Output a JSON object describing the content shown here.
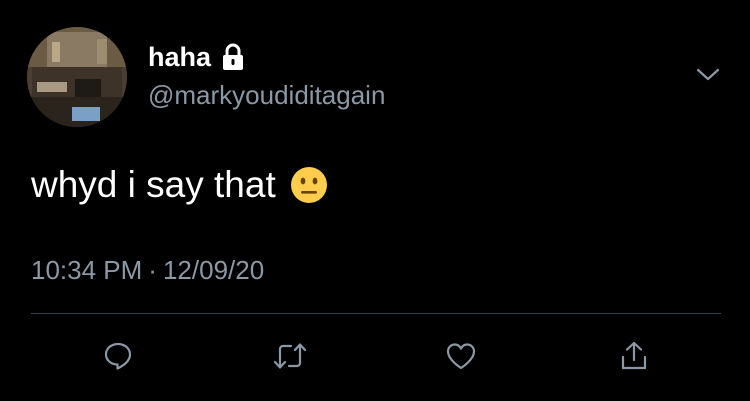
{
  "tweet": {
    "display_name": "haha",
    "handle": "@markyoudiditagain",
    "text": "whyd i say that",
    "emoji": "neutral-face",
    "time": "10:34 PM",
    "separator": "·",
    "date": "12/09/20"
  },
  "actions": [
    {
      "name": "reply",
      "icon": "reply-icon"
    },
    {
      "name": "retweet",
      "icon": "retweet-icon"
    },
    {
      "name": "like",
      "icon": "heart-icon"
    },
    {
      "name": "share",
      "icon": "share-icon"
    }
  ],
  "colors": {
    "background": "#000000",
    "primary_text": "#ffffff",
    "secondary_text": "#8b98a5",
    "icon": "#8b98a5",
    "divider": "#38444d"
  }
}
